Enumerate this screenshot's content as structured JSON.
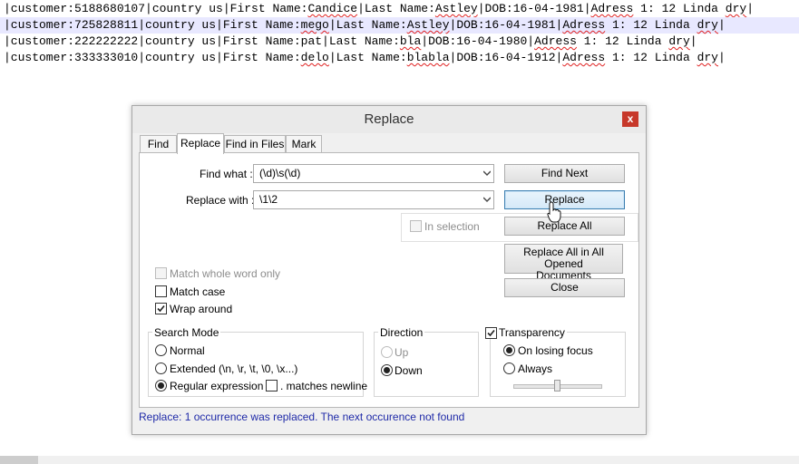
{
  "editor": {
    "lines": [
      {
        "a": "|customer:5188680107|country us|First Name:",
        "b": "Candice",
        "c": "|Last Name:",
        "d": "Astley",
        "e": "|DOB:16-04-1981|",
        "f": "Adress",
        "g": " 1: 12 Linda ",
        "h": "dry",
        "i": "|"
      },
      {
        "a": "|customer:725828811|country us|First Name:",
        "b": "mego",
        "c": "|Last Name:",
        "d": "Astley",
        "e": "|DOB:16-04-1981|",
        "f": "Adress",
        "g": " 1: 12 Linda ",
        "h": "dry",
        "i": "|"
      },
      {
        "a": "|customer:222222222|country us|First Name:pat|Last Name:",
        "b": "bla",
        "c": "|DOB:16-04-1980|",
        "d": "Adress",
        "e": " 1: 12 Linda ",
        "f": "dry",
        "g": "|"
      },
      {
        "a": "|customer:333333010|country us|First Name:",
        "b": "delo",
        "c": "|Last Name:",
        "d": "blabla",
        "e": "|DOB:16-04-1912|",
        "f": "Adress",
        "g": " 1: 12 Linda ",
        "h": "dry",
        "i": "|"
      }
    ]
  },
  "dialog": {
    "title": "Replace",
    "close_glyph": "x",
    "tabs": [
      {
        "label": "Find"
      },
      {
        "label": "Replace"
      },
      {
        "label": "Find in Files"
      },
      {
        "label": "Mark"
      }
    ],
    "find_what_label": "Find what :",
    "find_what_value": "(\\d)\\s(\\d)",
    "replace_with_label": "Replace with :",
    "replace_with_value": "\\1\\2",
    "in_selection_label": "In selection",
    "buttons": {
      "find_next": "Find Next",
      "replace": "Replace",
      "replace_all": "Replace All",
      "replace_all_opened_line1": "Replace All in All Opened",
      "replace_all_opened_line2": "Documents",
      "close": "Close"
    },
    "options": {
      "match_whole_word": "Match whole word only",
      "match_case": "Match case",
      "wrap_around": "Wrap around"
    },
    "search_mode": {
      "title": "Search Mode",
      "normal": "Normal",
      "extended": "Extended (\\n, \\r, \\t, \\0, \\x...)",
      "regex": "Regular expression",
      "matches_newline": ". matches newline"
    },
    "direction": {
      "title": "Direction",
      "up": "Up",
      "down": "Down"
    },
    "transparency": {
      "title": "Transparency",
      "on_losing_focus": "On losing focus",
      "always": "Always"
    },
    "status": "Replace: 1 occurrence was replaced. The next occurence not found"
  }
}
